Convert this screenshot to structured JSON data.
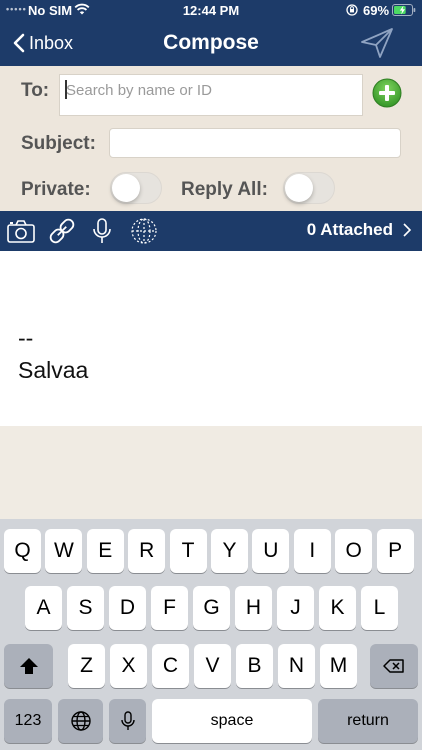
{
  "status_bar": {
    "signal_dots": "•••••",
    "carrier": "No SIM",
    "time": "12:44 PM",
    "battery_percent": "69%",
    "battery_level": 0.69
  },
  "nav": {
    "back_label": "Inbox",
    "title": "Compose",
    "send_icon": "send-paper-plane-icon"
  },
  "form": {
    "to_label": "To:",
    "to_placeholder": "Search by name or ID",
    "to_value": "",
    "subject_label": "Subject:",
    "subject_value": "",
    "private_label": "Private:",
    "private_on": false,
    "reply_all_label": "Reply All:",
    "reply_all_on": false
  },
  "toolbar": {
    "icons": [
      "camera-icon",
      "link-icon",
      "microphone-icon",
      "globe-icon"
    ],
    "attached_label": "0 Attached"
  },
  "body": {
    "signature_separator": "--",
    "signature_name": "Salvaa"
  },
  "keyboard": {
    "row1": [
      "Q",
      "W",
      "E",
      "R",
      "T",
      "Y",
      "U",
      "I",
      "O",
      "P"
    ],
    "row2": [
      "A",
      "S",
      "D",
      "F",
      "G",
      "H",
      "J",
      "K",
      "L"
    ],
    "row3": [
      "Z",
      "X",
      "C",
      "V",
      "B",
      "N",
      "M"
    ],
    "numbers_label": "123",
    "space_label": "space",
    "return_label": "return"
  },
  "colors": {
    "header_bg": "#1d3b69",
    "form_bg": "#ede6dc",
    "add_button": "#4caf3a"
  }
}
